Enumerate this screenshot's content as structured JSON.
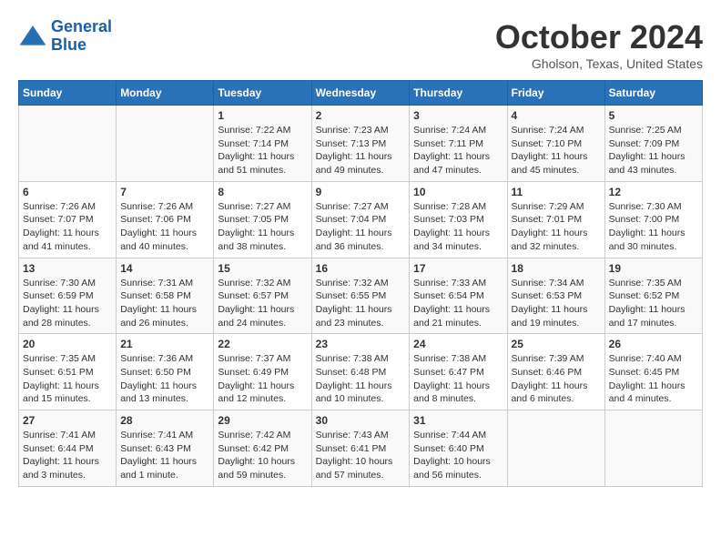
{
  "header": {
    "logo_line1": "General",
    "logo_line2": "Blue",
    "month": "October 2024",
    "location": "Gholson, Texas, United States"
  },
  "columns": [
    "Sunday",
    "Monday",
    "Tuesday",
    "Wednesday",
    "Thursday",
    "Friday",
    "Saturday"
  ],
  "weeks": [
    [
      {
        "day": "",
        "info": ""
      },
      {
        "day": "",
        "info": ""
      },
      {
        "day": "1",
        "info": "Sunrise: 7:22 AM\nSunset: 7:14 PM\nDaylight: 11 hours and 51 minutes."
      },
      {
        "day": "2",
        "info": "Sunrise: 7:23 AM\nSunset: 7:13 PM\nDaylight: 11 hours and 49 minutes."
      },
      {
        "day": "3",
        "info": "Sunrise: 7:24 AM\nSunset: 7:11 PM\nDaylight: 11 hours and 47 minutes."
      },
      {
        "day": "4",
        "info": "Sunrise: 7:24 AM\nSunset: 7:10 PM\nDaylight: 11 hours and 45 minutes."
      },
      {
        "day": "5",
        "info": "Sunrise: 7:25 AM\nSunset: 7:09 PM\nDaylight: 11 hours and 43 minutes."
      }
    ],
    [
      {
        "day": "6",
        "info": "Sunrise: 7:26 AM\nSunset: 7:07 PM\nDaylight: 11 hours and 41 minutes."
      },
      {
        "day": "7",
        "info": "Sunrise: 7:26 AM\nSunset: 7:06 PM\nDaylight: 11 hours and 40 minutes."
      },
      {
        "day": "8",
        "info": "Sunrise: 7:27 AM\nSunset: 7:05 PM\nDaylight: 11 hours and 38 minutes."
      },
      {
        "day": "9",
        "info": "Sunrise: 7:27 AM\nSunset: 7:04 PM\nDaylight: 11 hours and 36 minutes."
      },
      {
        "day": "10",
        "info": "Sunrise: 7:28 AM\nSunset: 7:03 PM\nDaylight: 11 hours and 34 minutes."
      },
      {
        "day": "11",
        "info": "Sunrise: 7:29 AM\nSunset: 7:01 PM\nDaylight: 11 hours and 32 minutes."
      },
      {
        "day": "12",
        "info": "Sunrise: 7:30 AM\nSunset: 7:00 PM\nDaylight: 11 hours and 30 minutes."
      }
    ],
    [
      {
        "day": "13",
        "info": "Sunrise: 7:30 AM\nSunset: 6:59 PM\nDaylight: 11 hours and 28 minutes."
      },
      {
        "day": "14",
        "info": "Sunrise: 7:31 AM\nSunset: 6:58 PM\nDaylight: 11 hours and 26 minutes."
      },
      {
        "day": "15",
        "info": "Sunrise: 7:32 AM\nSunset: 6:57 PM\nDaylight: 11 hours and 24 minutes."
      },
      {
        "day": "16",
        "info": "Sunrise: 7:32 AM\nSunset: 6:55 PM\nDaylight: 11 hours and 23 minutes."
      },
      {
        "day": "17",
        "info": "Sunrise: 7:33 AM\nSunset: 6:54 PM\nDaylight: 11 hours and 21 minutes."
      },
      {
        "day": "18",
        "info": "Sunrise: 7:34 AM\nSunset: 6:53 PM\nDaylight: 11 hours and 19 minutes."
      },
      {
        "day": "19",
        "info": "Sunrise: 7:35 AM\nSunset: 6:52 PM\nDaylight: 11 hours and 17 minutes."
      }
    ],
    [
      {
        "day": "20",
        "info": "Sunrise: 7:35 AM\nSunset: 6:51 PM\nDaylight: 11 hours and 15 minutes."
      },
      {
        "day": "21",
        "info": "Sunrise: 7:36 AM\nSunset: 6:50 PM\nDaylight: 11 hours and 13 minutes."
      },
      {
        "day": "22",
        "info": "Sunrise: 7:37 AM\nSunset: 6:49 PM\nDaylight: 11 hours and 12 minutes."
      },
      {
        "day": "23",
        "info": "Sunrise: 7:38 AM\nSunset: 6:48 PM\nDaylight: 11 hours and 10 minutes."
      },
      {
        "day": "24",
        "info": "Sunrise: 7:38 AM\nSunset: 6:47 PM\nDaylight: 11 hours and 8 minutes."
      },
      {
        "day": "25",
        "info": "Sunrise: 7:39 AM\nSunset: 6:46 PM\nDaylight: 11 hours and 6 minutes."
      },
      {
        "day": "26",
        "info": "Sunrise: 7:40 AM\nSunset: 6:45 PM\nDaylight: 11 hours and 4 minutes."
      }
    ],
    [
      {
        "day": "27",
        "info": "Sunrise: 7:41 AM\nSunset: 6:44 PM\nDaylight: 11 hours and 3 minutes."
      },
      {
        "day": "28",
        "info": "Sunrise: 7:41 AM\nSunset: 6:43 PM\nDaylight: 11 hours and 1 minute."
      },
      {
        "day": "29",
        "info": "Sunrise: 7:42 AM\nSunset: 6:42 PM\nDaylight: 10 hours and 59 minutes."
      },
      {
        "day": "30",
        "info": "Sunrise: 7:43 AM\nSunset: 6:41 PM\nDaylight: 10 hours and 57 minutes."
      },
      {
        "day": "31",
        "info": "Sunrise: 7:44 AM\nSunset: 6:40 PM\nDaylight: 10 hours and 56 minutes."
      },
      {
        "day": "",
        "info": ""
      },
      {
        "day": "",
        "info": ""
      }
    ]
  ]
}
